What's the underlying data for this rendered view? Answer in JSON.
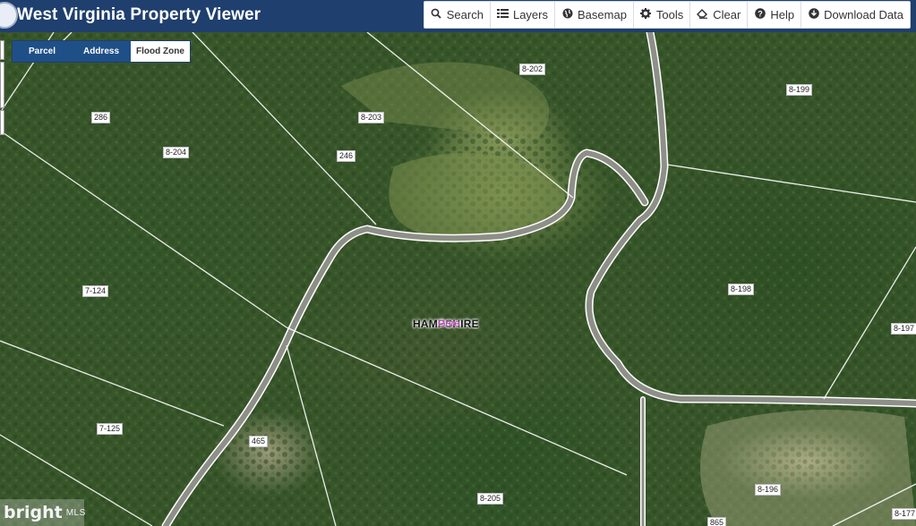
{
  "header": {
    "title": "West Virginia Property Viewer",
    "tools": [
      {
        "label": "Search",
        "icon": "search-icon",
        "glyph": "🔍"
      },
      {
        "label": "Layers",
        "icon": "layers-icon",
        "glyph": "☰"
      },
      {
        "label": "Basemap",
        "icon": "globe-icon",
        "glyph": "◍"
      },
      {
        "label": "Tools",
        "icon": "gear-icon",
        "glyph": "⚙"
      },
      {
        "label": "Clear",
        "icon": "eraser-icon",
        "glyph": "✀"
      },
      {
        "label": "Help",
        "icon": "help-icon",
        "glyph": "?"
      },
      {
        "label": "Download Data",
        "icon": "download-icon",
        "glyph": "⤓"
      }
    ]
  },
  "tabs": {
    "parcel": "Parcel",
    "address": "Address",
    "flood_zone": "Flood Zone",
    "active": "Flood Zone"
  },
  "map": {
    "place_name": "HAMPSHIRE",
    "place_sub": "Gore",
    "parcels": [
      "286",
      "8-204",
      "8-203",
      "246",
      "8-202",
      "8-199",
      "7-124",
      "8-198",
      "8-197",
      "7-125",
      "465",
      "8-205",
      "8-196",
      "8-177",
      "865"
    ],
    "colors": {
      "parcel_line": "#ffffff",
      "road": "#9a9b94",
      "place_sub": "#d12ad1",
      "header": "#1f3f6e",
      "tab_bg": "#1f4f87"
    }
  },
  "watermark": {
    "brand": "bright",
    "suffix": "MLS"
  }
}
